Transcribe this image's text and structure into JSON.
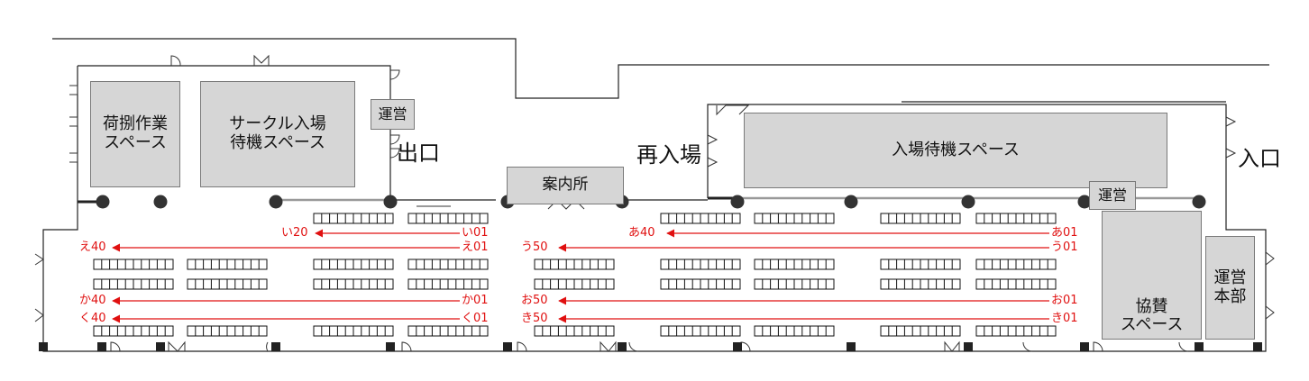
{
  "colors": {
    "route_red": "#e01010",
    "zone_fill": "#d6d6d6",
    "wall": "#222222"
  },
  "zones": {
    "loading": "荷捌作業\nスペース",
    "circle_wait": "サークル入場\n待機スペース",
    "staff_exit": "運営",
    "info": "案内所",
    "entry_wait": "入場待機スペース",
    "staff_entry": "運営",
    "sponsor": "協賛\nスペース",
    "hq": "運営\n本部"
  },
  "signs": {
    "exit": "出口",
    "reentry": "再入場",
    "entrance": "入口"
  },
  "rows": {
    "i": {
      "start": "い01",
      "end": "い20"
    },
    "e": {
      "start": "え01",
      "end": "え40"
    },
    "ka": {
      "start": "か01",
      "end": "か40"
    },
    "ku": {
      "start": "く01",
      "end": "く40"
    },
    "a": {
      "start": "あ01",
      "end": "あ40"
    },
    "u": {
      "start": "う01",
      "end": "う50"
    },
    "o": {
      "start": "お01",
      "end": "お50"
    },
    "ki": {
      "start": "き01",
      "end": "き50"
    }
  }
}
